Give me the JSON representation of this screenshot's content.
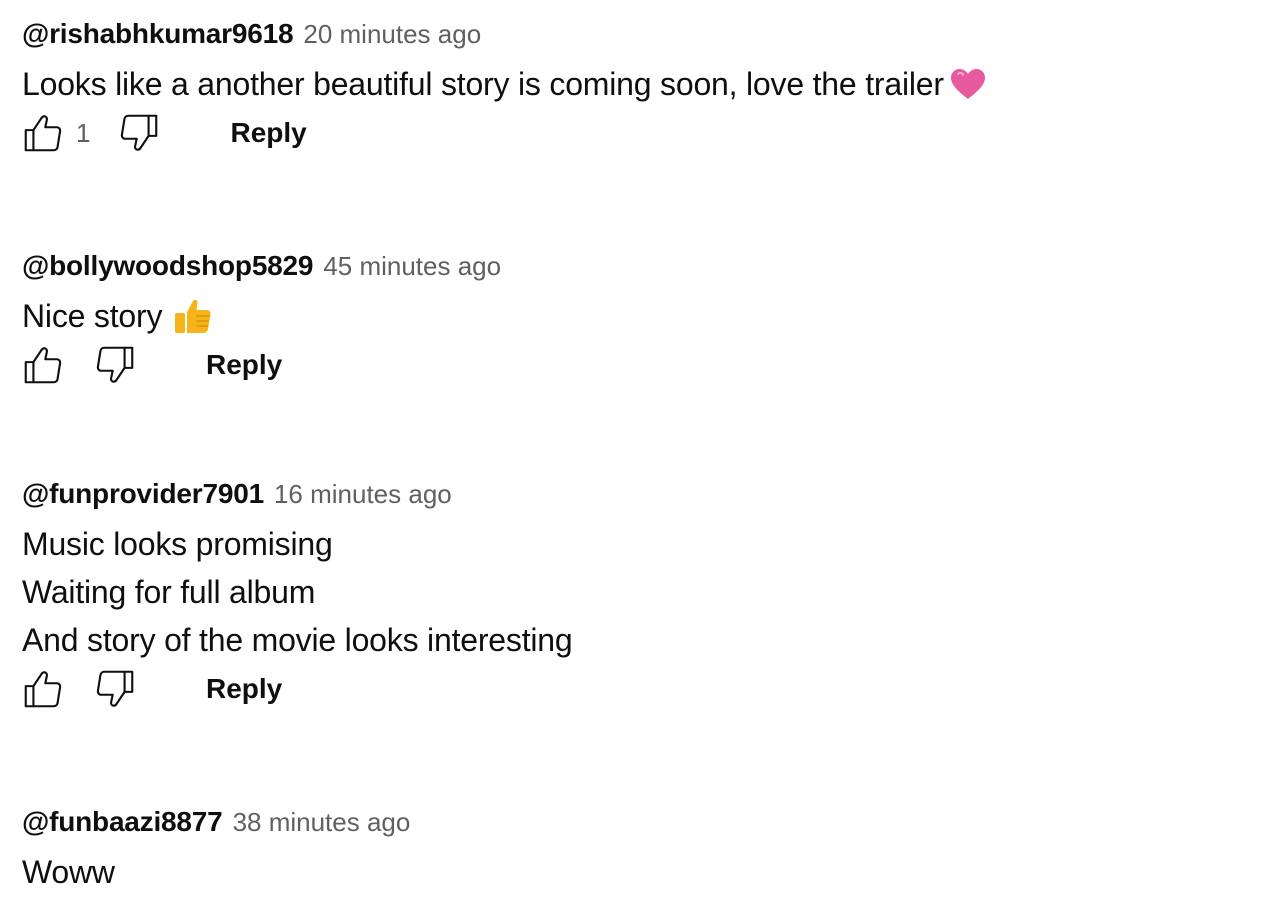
{
  "comments": [
    {
      "author": "@rishabhkumar9618",
      "time": "20 minutes ago",
      "text_lines": [
        "Looks like a another beautiful story is coming soon, love the trailer"
      ],
      "emoji": "pink-heart",
      "like_count": "1",
      "reply_label": "Reply"
    },
    {
      "author": "@bollywoodshop5829",
      "time": "45 minutes ago",
      "text_lines": [
        "Nice story"
      ],
      "emoji": "thumbs-up",
      "like_count": "",
      "reply_label": "Reply"
    },
    {
      "author": "@funprovider7901",
      "time": "16 minutes ago",
      "text_lines": [
        "Music looks promising",
        "Waiting for full album",
        "And story of the movie looks interesting"
      ],
      "like_count": "",
      "reply_label": "Reply"
    },
    {
      "author": "@funbaazi8877",
      "time": "38 minutes ago",
      "text_lines": [
        "Woww"
      ]
    }
  ],
  "icons": {
    "like": "thumbs-up-outline-icon",
    "dislike": "thumbs-down-outline-icon"
  },
  "colors": {
    "text": "#0f0f0f",
    "secondary": "#606060",
    "heart": "#e85a9e",
    "thumb_emoji": "#f5b419"
  }
}
